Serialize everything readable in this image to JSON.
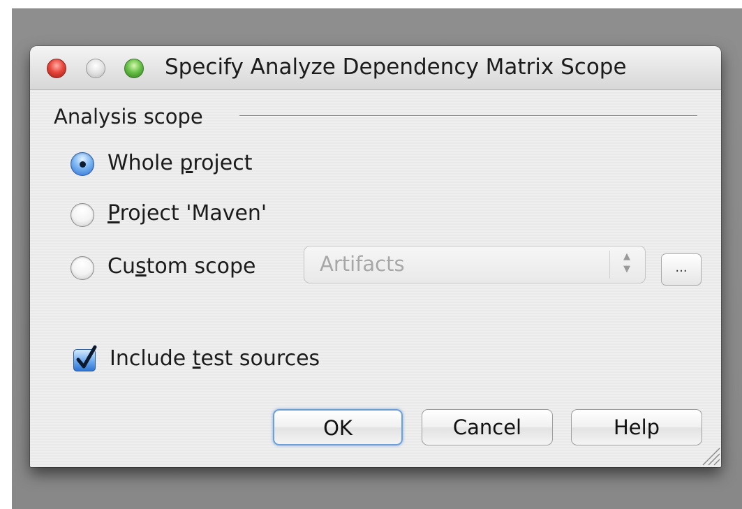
{
  "window": {
    "title": "Specify Analyze Dependency Matrix Scope"
  },
  "analysis_scope": {
    "group_label": "Analysis scope",
    "options": [
      {
        "pre": "Whole ",
        "mnemonic": "p",
        "post": "roject",
        "selected": true
      },
      {
        "pre": "",
        "mnemonic": "P",
        "post": "roject 'Maven'",
        "selected": false
      },
      {
        "pre": "Cu",
        "mnemonic": "s",
        "post": "tom scope",
        "selected": false
      }
    ],
    "custom_scope_select": {
      "value": "Artifacts",
      "enabled": false
    },
    "browse_button_label": "..."
  },
  "include_test_sources": {
    "pre": "Include ",
    "mnemonic": "t",
    "post": "est sources",
    "checked": true
  },
  "buttons": {
    "ok": "OK",
    "cancel": "Cancel",
    "help": "Help"
  },
  "colors": {
    "backdrop": "#8c8c8c",
    "selected_radio": "#2a6fd2",
    "default_button_ring": "#6d9fd8"
  }
}
